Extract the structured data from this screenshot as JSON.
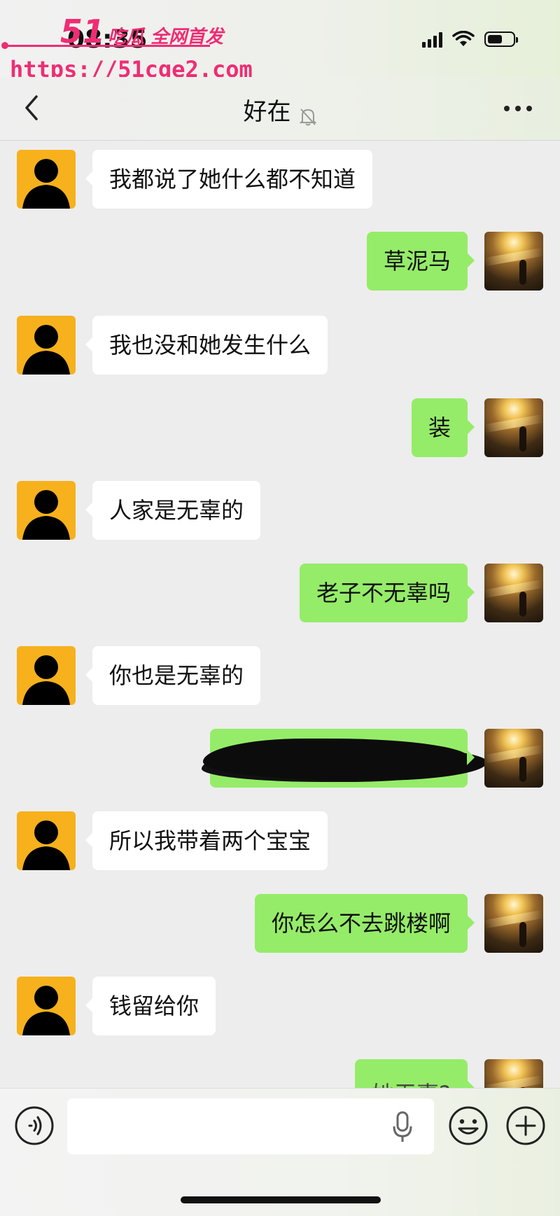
{
  "status_bar": {
    "time": "08:35",
    "watermark_brand_num": "51",
    "watermark_brand_text": "吃瓜 全网首发",
    "watermark_url": "https://51cge2.com"
  },
  "header": {
    "title": "好在",
    "back_icon": "chevron-left-icon",
    "mute_icon": "bell-slash-icon",
    "more_icon": "ellipsis-icon"
  },
  "messages": [
    {
      "side": "in",
      "text": "我都说了她什么都不知道"
    },
    {
      "side": "out",
      "text": "草泥马"
    },
    {
      "side": "in",
      "text": "我也没和她发生什么"
    },
    {
      "side": "out",
      "text": "装"
    },
    {
      "side": "in",
      "text": "人家是无辜的"
    },
    {
      "side": "out",
      "text": "老子不无辜吗"
    },
    {
      "side": "in",
      "text": "你也是无辜的"
    },
    {
      "side": "out",
      "text": "",
      "redacted": true
    },
    {
      "side": "in",
      "text": "所以我带着两个宝宝"
    },
    {
      "side": "out",
      "text": "你怎么不去跳楼啊"
    },
    {
      "side": "in",
      "text": "钱留给你"
    },
    {
      "side": "out",
      "text": "她无辜?"
    }
  ],
  "input_bar": {
    "placeholder": "",
    "voice_icon": "voice-icon",
    "mic_icon": "microphone-icon",
    "emoji_icon": "smiley-icon",
    "plus_icon": "plus-circle-icon"
  },
  "colors": {
    "outgoing_bubble": "#95ec69",
    "incoming_bubble": "#ffffff",
    "background": "#ededed",
    "watermark": "#ee2d74",
    "avatar_incoming": "#f6b11c"
  }
}
